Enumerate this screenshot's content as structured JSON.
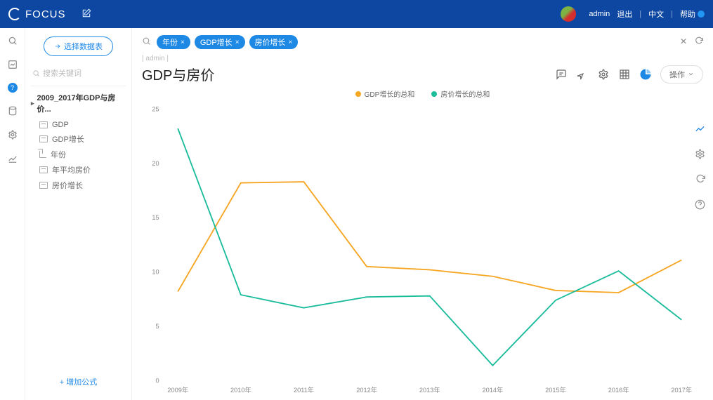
{
  "header": {
    "brand": "FOCUS",
    "user": "admin",
    "logout": "退出",
    "lang": "中文",
    "help": "帮助"
  },
  "sidebar": {
    "select_table_btn": "选择数据表",
    "search_placeholder": "搜索关键词",
    "dataset_title": "2009_2017年GDP与房价...",
    "fields": [
      {
        "label": "GDP",
        "type": "num"
      },
      {
        "label": "GDP增长",
        "type": "num"
      },
      {
        "label": "年份",
        "type": "date"
      },
      {
        "label": "年平均房价",
        "type": "num"
      },
      {
        "label": "房价增长",
        "type": "num"
      }
    ],
    "add_formula": "+ 增加公式"
  },
  "chips": [
    {
      "label": "年份"
    },
    {
      "label": "GDP增长"
    },
    {
      "label": "房价增长"
    }
  ],
  "crumb": "| admin |",
  "chart_title": "GDP与房价",
  "ops_label": "操作",
  "chart_data": {
    "type": "line",
    "title": "GDP与房价",
    "categories": [
      "2009年",
      "2010年",
      "2011年",
      "2012年",
      "2013年",
      "2014年",
      "2015年",
      "2016年",
      "2017年"
    ],
    "yticks": [
      0,
      5,
      10,
      15,
      20,
      25
    ],
    "ylim": [
      0,
      25
    ],
    "series": [
      {
        "name": "GDP增长的总和",
        "color": "#f6a623",
        "values": [
          8.2,
          18.2,
          18.3,
          10.5,
          10.2,
          9.6,
          8.3,
          8.1,
          11.1
        ]
      },
      {
        "name": "房价增长的总和",
        "color": "#1bbc9b",
        "values": [
          23.2,
          7.9,
          6.7,
          7.7,
          7.8,
          1.4,
          7.4,
          10.1,
          5.6
        ]
      }
    ]
  },
  "colors": {
    "brand": "#0d47a1",
    "accent": "#1e88e5"
  }
}
